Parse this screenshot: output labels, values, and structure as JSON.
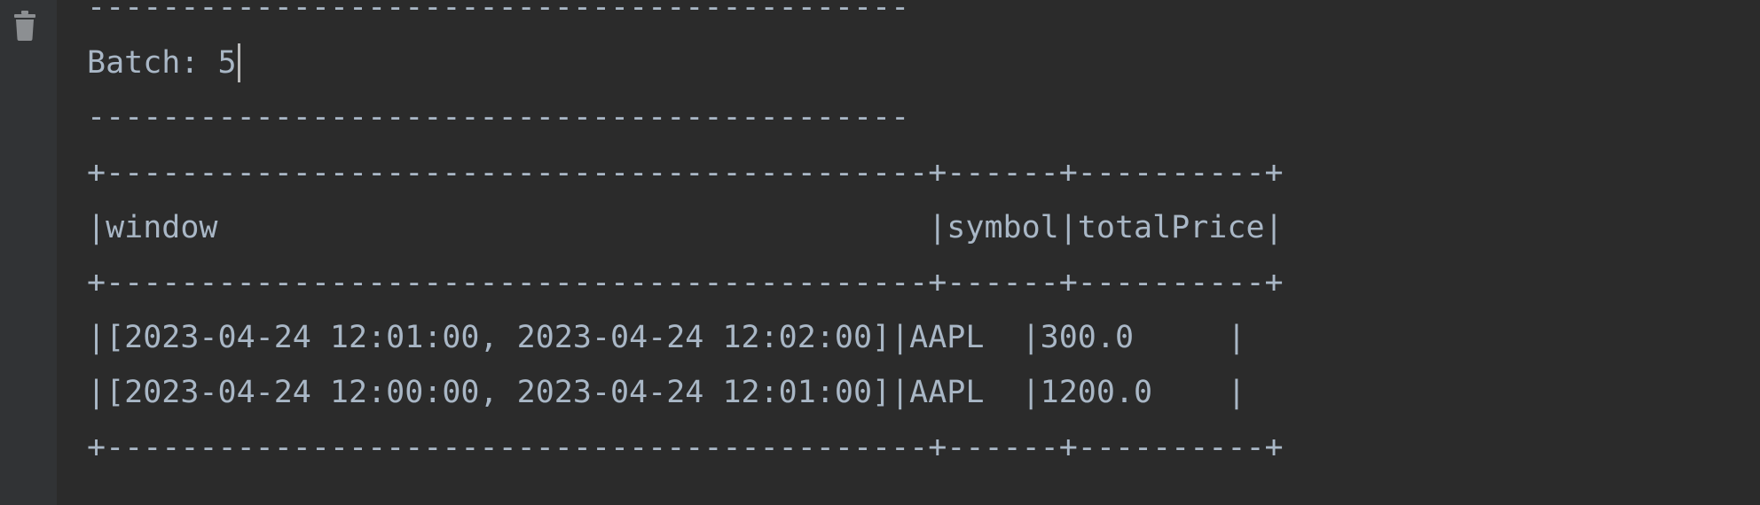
{
  "console": {
    "toolbar": {
      "clear_icon": "trash-icon"
    },
    "lines": {
      "sep_top": "--------------------------------------------",
      "batch": "Batch: 5",
      "sep_mid": "--------------------------------------------",
      "table_border_1": "+--------------------------------------------+------+----------+",
      "header": "|window                                      |symbol|totalPrice|",
      "table_border_2": "+--------------------------------------------+------+----------+",
      "row_1": "|[2023-04-24 12:01:00, 2023-04-24 12:02:00]|AAPL  |300.0     |",
      "row_2": "|[2023-04-24 12:00:00, 2023-04-24 12:01:00]|AAPL  |1200.0    |",
      "table_border_3": "+--------------------------------------------+------+----------+"
    }
  }
}
